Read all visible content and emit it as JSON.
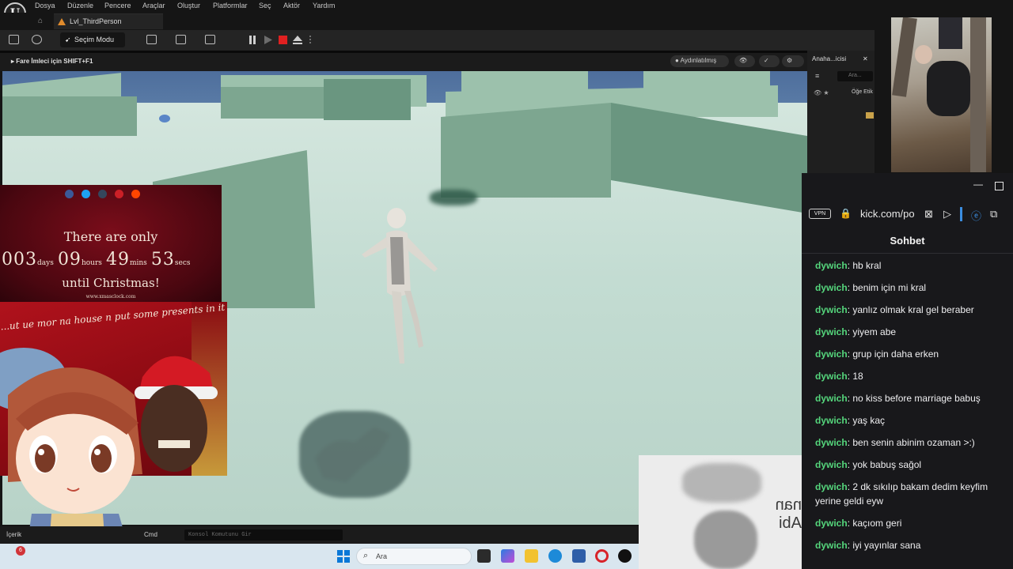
{
  "menubar": {
    "items": [
      "Dosya",
      "Düzenle",
      "Pencere",
      "Araçlar",
      "Oluştur",
      "Platformlar",
      "Seç",
      "Aktör",
      "Yardım"
    ]
  },
  "tabs": {
    "level": "Lvl_ThirdPerson"
  },
  "toolbar": {
    "mode": "Seçim Modu"
  },
  "viewport": {
    "hint": "Fare İmleci için SHIFT+F1",
    "lighting": "Aydınlatılmış"
  },
  "outliner": {
    "tab": "Anaha...icisi",
    "search_placeholder": "Ara...",
    "col_label": "Öğe Etik"
  },
  "christmas": {
    "line1": "There are only",
    "days": "003",
    "days_label": "days",
    "hours": "09",
    "hours_label": "hours",
    "mins": "49",
    "mins_label": "mins",
    "secs": "53",
    "secs_label": "secs",
    "line2": "until Christmas!",
    "url": "www.xmasclock.com"
  },
  "santa_card": {
    "curve_text": "...ut ue mor na house n put some presents in it"
  },
  "bottom_bar": {
    "content_label": "İçerik",
    "cmd_label": "Cmd",
    "console_placeholder": "Konsol Komutunu Gir"
  },
  "taskbar": {
    "search_label": "Ara",
    "badge": "6"
  },
  "meme": {
    "text": "nan Abi"
  },
  "browser": {
    "vpn": "VPN",
    "url": "kick.com/po"
  },
  "chat": {
    "title": "Sohbet",
    "messages": [
      {
        "user": "dywich",
        "text": "hb kral"
      },
      {
        "user": "dywich",
        "text": "benim için mi kral"
      },
      {
        "user": "dywich",
        "text": "yanlız olmak kral gel beraber"
      },
      {
        "user": "dywich",
        "text": "yiyem abe"
      },
      {
        "user": "dywich",
        "text": "grup için daha erken"
      },
      {
        "user": "dywich",
        "text": "18"
      },
      {
        "user": "dywich",
        "text": "no kiss before marriage babuş"
      },
      {
        "user": "dywich",
        "text": "yaş kaç"
      },
      {
        "user": "dywich",
        "text": "ben senin abinim ozaman >:)"
      },
      {
        "user": "dywich",
        "text": "yok babuş sağol"
      },
      {
        "user": "dywich",
        "text": "2 dk sıkılıp bakam dedim keyfim yerine geldi eyw"
      },
      {
        "user": "dywich",
        "text": "kaçıom geri"
      },
      {
        "user": "dywich",
        "text": "iyi yayınlar sana"
      }
    ]
  },
  "colors": {
    "chat_user": "#55d67c",
    "chat_bg": "#18181b",
    "ue_bg": "#151515",
    "wall": "#7da690",
    "floor": "#c6ddd4"
  }
}
